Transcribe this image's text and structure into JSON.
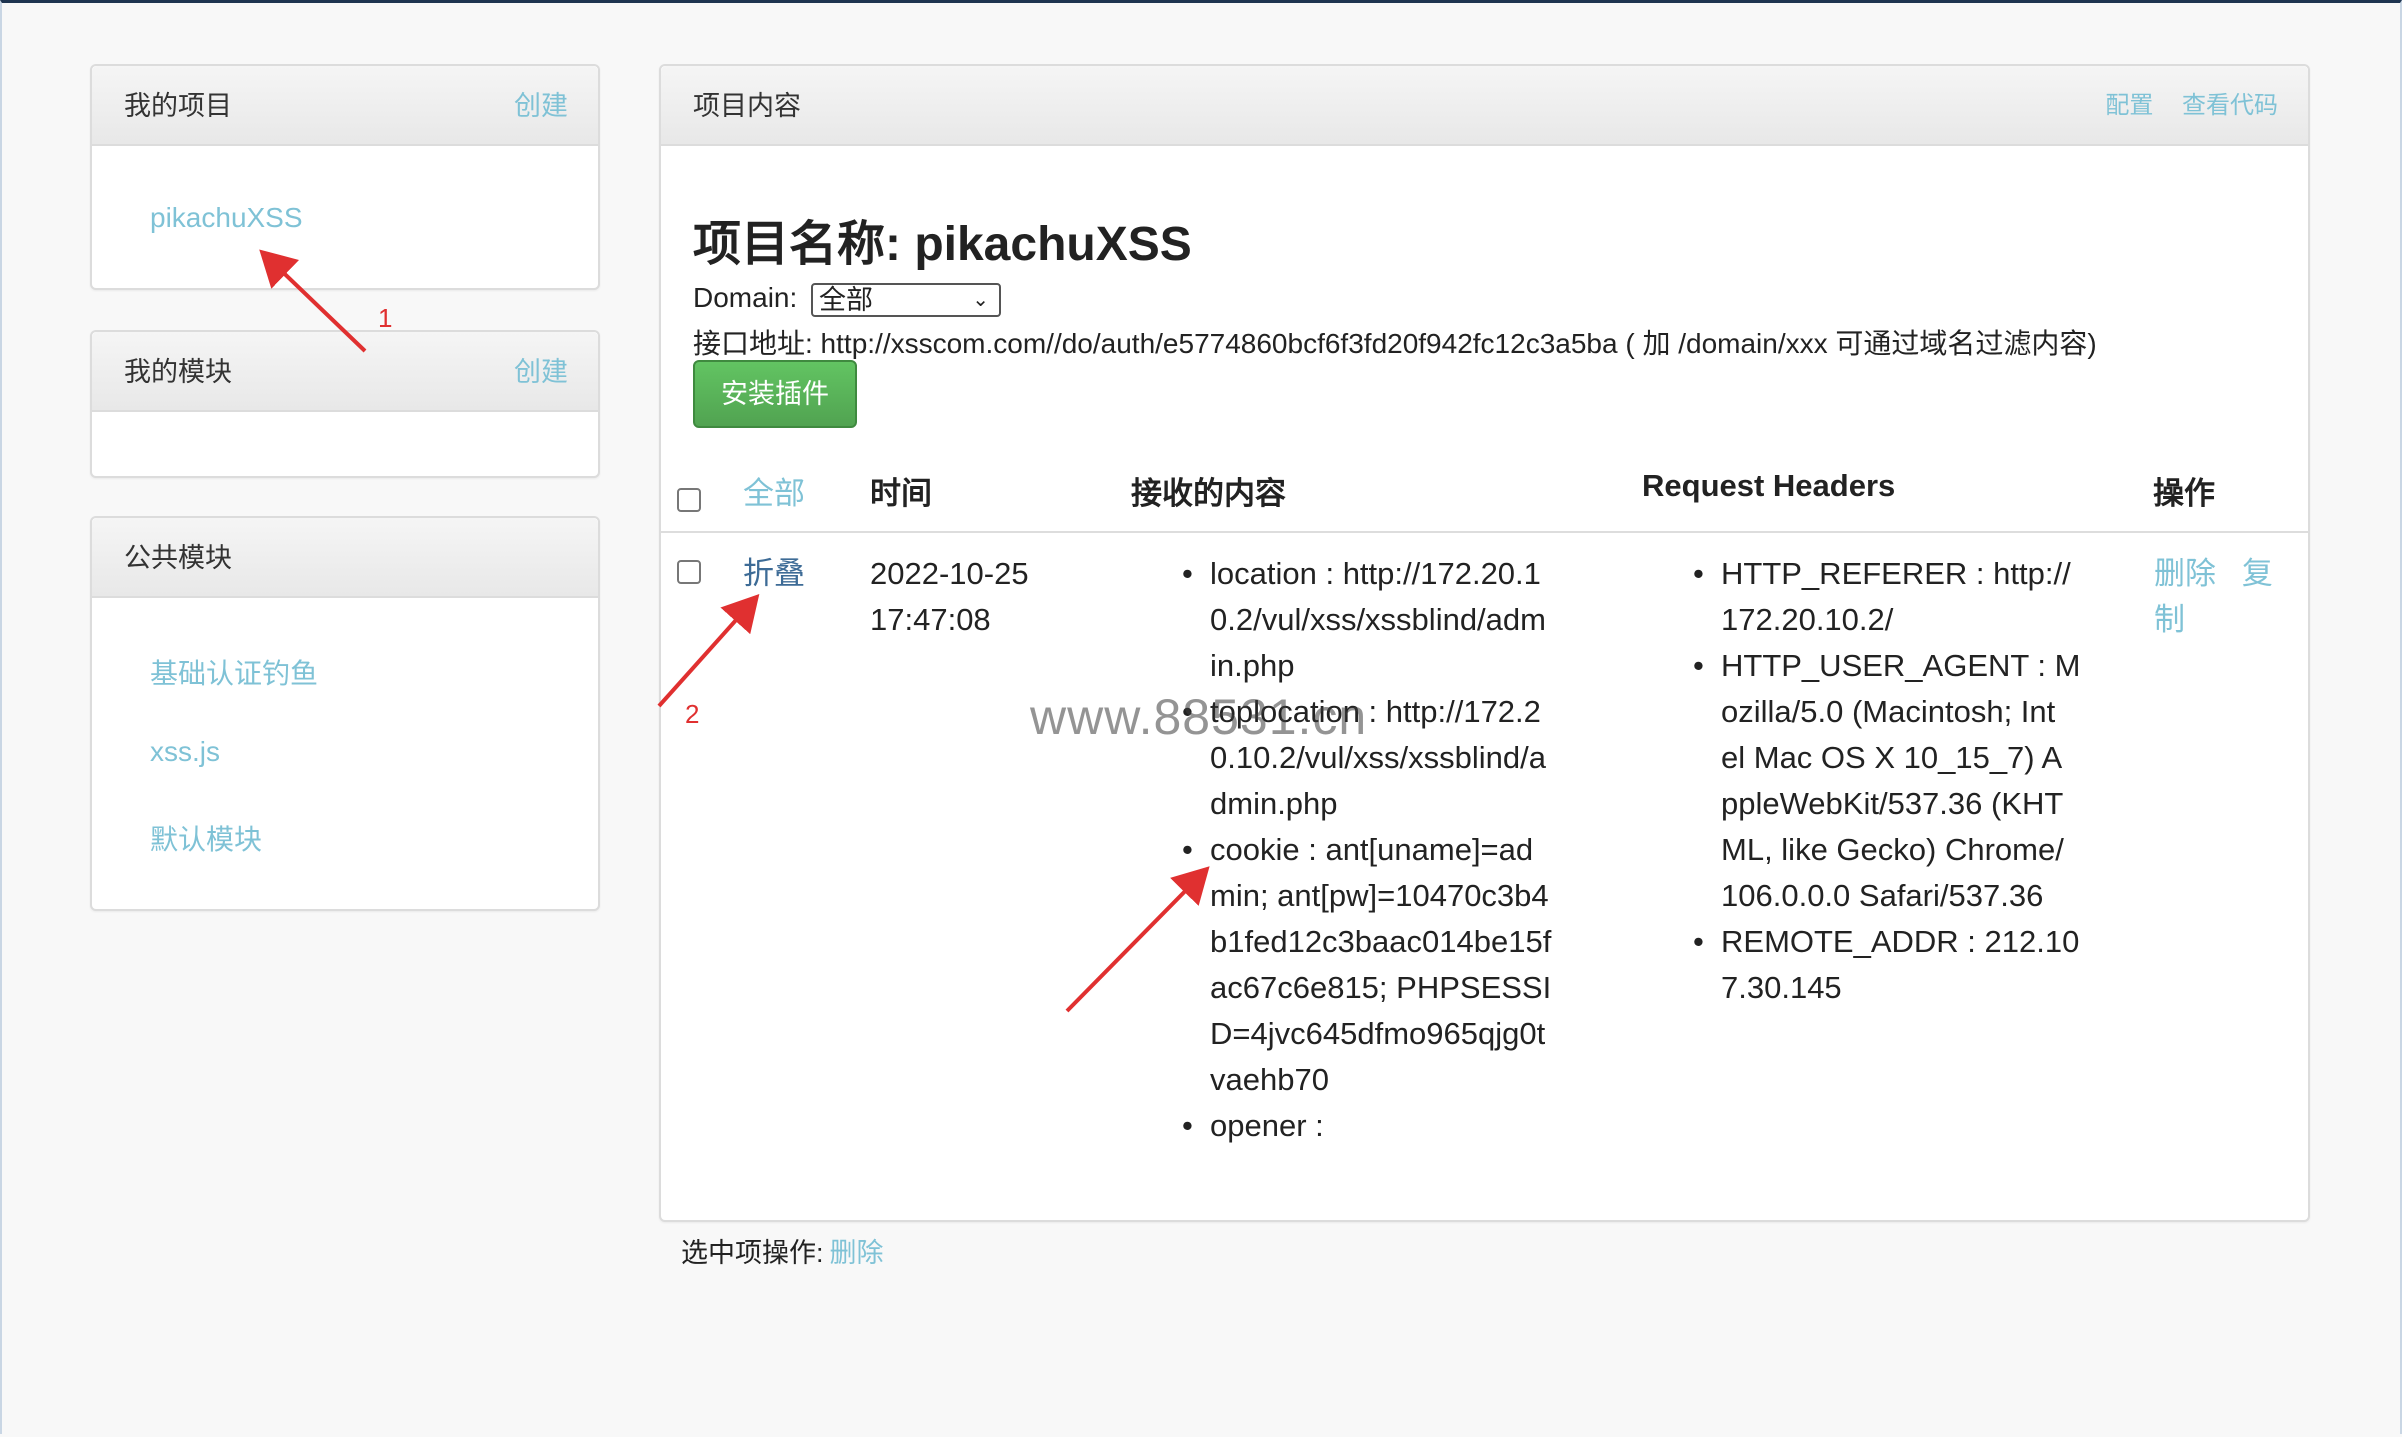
{
  "sidebar": {
    "my_projects": {
      "title": "我的项目",
      "create": "创建",
      "items": [
        "pikachuXSS"
      ]
    },
    "my_modules": {
      "title": "我的模块",
      "create": "创建"
    },
    "public_modules": {
      "title": "公共模块",
      "items": [
        "基础认证钓鱼",
        "xss.js",
        "默认模块"
      ]
    }
  },
  "main": {
    "header": {
      "title": "项目内容",
      "config": "配置",
      "view_code": "查看代码"
    },
    "project_title": "项目名称: pikachuXSS",
    "domain_label": "Domain:",
    "domain_value": "全部",
    "api_address": "接口地址: http://xsscom.com//do/auth/e5774860bcf6f3fd20f942fc12c3a5ba ( 加 /domain/xxx 可通过域名过滤内容)",
    "install_button": "安装插件",
    "table": {
      "headers": {
        "all": "全部",
        "time": "时间",
        "content": "接收的内容",
        "request_headers": "Request Headers",
        "actions": "操作"
      },
      "rows": [
        {
          "toggle": "折叠",
          "time_line1": "2022-10-25",
          "time_line2": "17:47:08",
          "content": [
            [
              "location : http://172.20.1",
              "0.2/vul/xss/xssblind/adm",
              "in.php"
            ],
            [
              "toplocation : http://172.2",
              "0.10.2/vul/xss/xssblind/a",
              "dmin.php"
            ],
            [
              "cookie : ant[uname]=ad",
              "min; ant[pw]=10470c3b4",
              "b1fed12c3baac014be15f",
              "ac67c6e815; PHPSESSI",
              "D=4jvc645dfmo965qjg0t",
              "vaehb70"
            ],
            [
              "opener :"
            ]
          ],
          "headers": [
            [
              "HTTP_REFERER : http://",
              "172.20.10.2/"
            ],
            [
              "HTTP_USER_AGENT : M",
              "ozilla/5.0 (Macintosh; Int",
              "el Mac OS X 10_15_7) A",
              "ppleWebKit/537.36 (KHT",
              "ML, like Gecko) Chrome/",
              "106.0.0.0 Safari/537.36"
            ],
            [
              "REMOTE_ADDR : 212.10",
              "7.30.145"
            ]
          ],
          "delete": "删除",
          "copy_line1": "复",
          "copy_line2": "制"
        }
      ]
    },
    "footer": {
      "label": "选中项操作:",
      "delete": "删除"
    }
  },
  "watermark": "www.88531.cn",
  "annotations": [
    "1",
    "2"
  ],
  "colors": {
    "link": "#7fc2d6",
    "dark_link": "#3d6b96",
    "button_green": "#5bb75b",
    "arrow_red": "#e03030"
  }
}
